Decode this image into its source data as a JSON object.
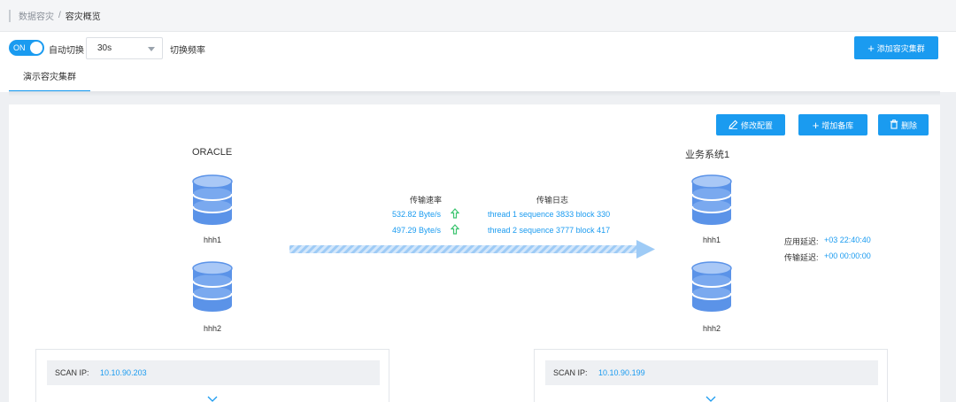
{
  "breadcrumb": {
    "parent": "数据容灾",
    "separator": "/",
    "current": "容灾概览"
  },
  "toolbar": {
    "toggle_label": "ON",
    "auto_switch_label": "自动切换",
    "interval_value": "30s",
    "interval_suffix": "切换频率",
    "add_cluster_label": "添加容灾集群"
  },
  "tabs": [
    {
      "label": "演示容灾集群",
      "active": true
    }
  ],
  "panel": {
    "edit_config_label": "修改配置",
    "add_standby_label": "增加备库",
    "delete_label": "删除"
  },
  "source": {
    "title": "ORACLE",
    "nodes": [
      {
        "label": "hhh1"
      },
      {
        "label": "hhh2"
      }
    ],
    "scan_ip_label": "SCAN IP:",
    "scan_ip": "10.10.90.203"
  },
  "target": {
    "title": "业务系统1",
    "nodes": [
      {
        "label": "hhh1"
      },
      {
        "label": "hhh2"
      }
    ],
    "scan_ip_label": "SCAN IP:",
    "scan_ip": "10.10.90.199"
  },
  "transfer": {
    "rate_header": "传输速率",
    "rates": [
      "532.82 Byte/s",
      "497.29 Byte/s"
    ],
    "log_header": "传输日志",
    "logs": [
      "thread 1 sequence 3833 block 330",
      "thread 2 sequence 3777 block 417"
    ]
  },
  "delays": {
    "apply_label": "应用延迟:",
    "apply_value": "+03 22:40:40",
    "transfer_label": "传输延迟:",
    "transfer_value": "+00 00:00:00"
  },
  "colors": {
    "accent": "#1a9bf0",
    "db_fill": "#5b93e8",
    "rate_arrow": "#3bc46f"
  },
  "icons": {
    "edit": "pencil-icon",
    "add": "plus-icon",
    "delete": "trash-icon",
    "database": "database-icon",
    "up_arrow": "arrow-up-icon",
    "expand": "chevron-down-icon"
  }
}
